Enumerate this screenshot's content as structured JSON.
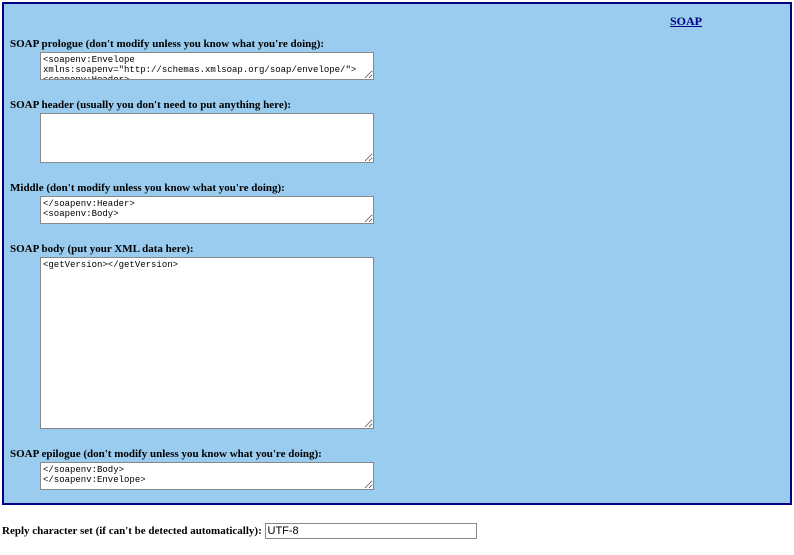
{
  "header": {
    "link_text": "SOAP"
  },
  "fields": {
    "prologue": {
      "label": "SOAP prologue (don't modify unless you know what you're doing):",
      "value": "<soapenv:Envelope xmlns:soapenv=\"http://schemas.xmlsoap.org/soap/envelope/\">\n<soapenv:Header>"
    },
    "soap_header": {
      "label": "SOAP header (usually you don't need to put anything here):",
      "value": ""
    },
    "middle": {
      "label": "Middle (don't modify unless you know what you're doing):",
      "value": "</soapenv:Header>\n<soapenv:Body>"
    },
    "body": {
      "label": "SOAP body (put your XML data here):",
      "value": "<getVersion></getVersion>"
    },
    "epilogue": {
      "label": "SOAP epilogue (don't modify unless you know what you're doing):",
      "value": "</soapenv:Body>\n</soapenv:Envelope>"
    }
  },
  "charset": {
    "label": "Reply character set (if can't be detected automatically):",
    "value": "UTF-8"
  }
}
